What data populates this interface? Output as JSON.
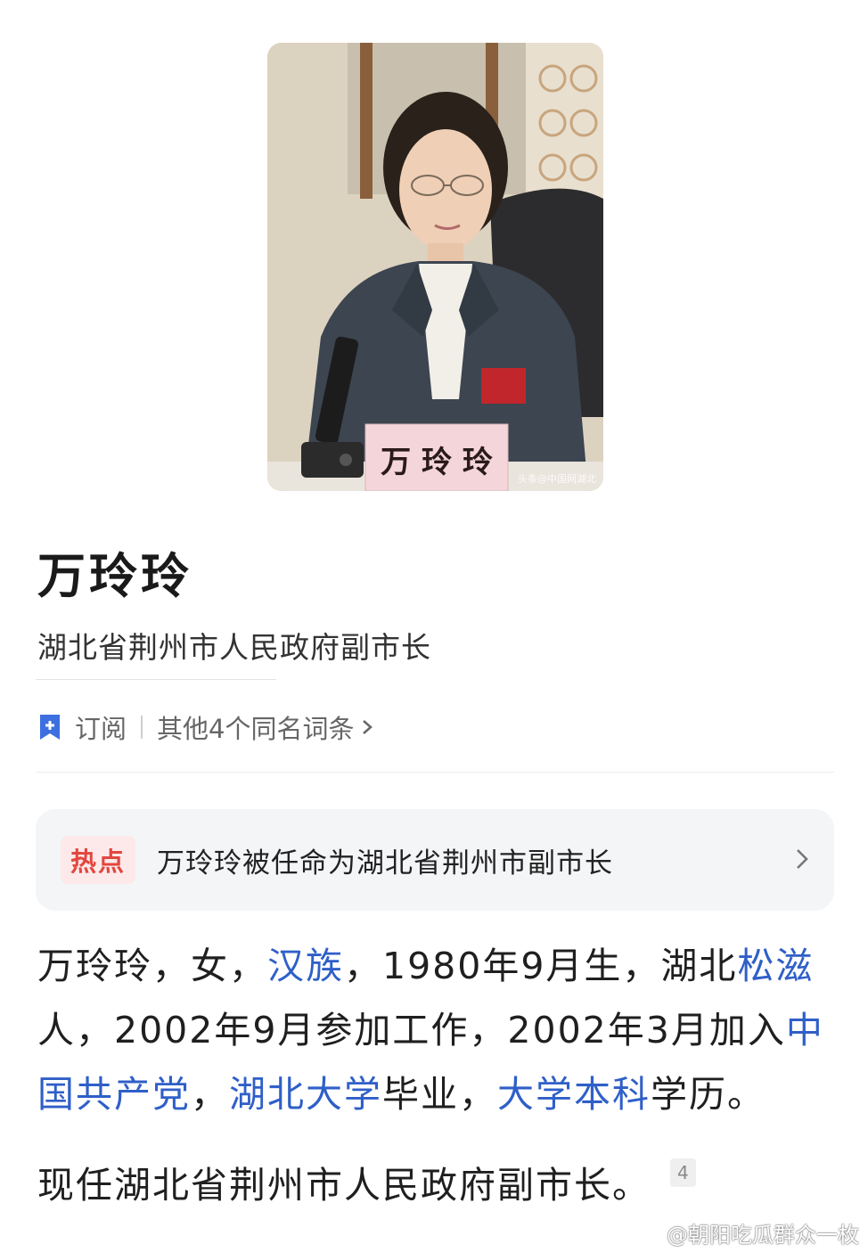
{
  "photo": {
    "nameplate_text": "万 玲 玲",
    "credit": "头条@中国网湖北"
  },
  "title": "万玲玲",
  "subtitle": "湖北省荆州市人民政府副市长",
  "meta": {
    "subscribe_label": "订阅",
    "other_entries_label": "其他4个同名词条"
  },
  "hot": {
    "tag": "热点",
    "text": "万玲玲被任命为湖北省荆州市副市长"
  },
  "paragraph1": {
    "t1": "万玲玲，女，",
    "link1": "汉族",
    "t2": "，1980年9月生，湖北",
    "link2": "松滋",
    "t3": "人，2002年9月参加工作，2002年3月加入",
    "link3": "中国共产党",
    "t4": "，",
    "link4": "湖北大学",
    "t5": "毕业，",
    "link5": "大学本科",
    "t6": "学历。"
  },
  "paragraph2": {
    "text": "现任湖北省荆州市人民政府副市长。",
    "ref": "4"
  },
  "watermark": "@朝阳吃瓜群众一枚",
  "colors": {
    "link": "#2f5fc8",
    "hot_tag": "#e2463f",
    "subscribe_icon": "#3d6fe0"
  }
}
